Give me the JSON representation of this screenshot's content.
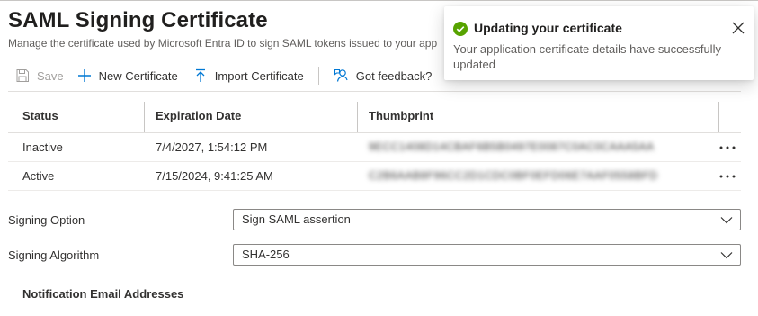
{
  "page": {
    "title": "SAML Signing Certificate",
    "subtitle": "Manage the certificate used by Microsoft Entra ID to sign SAML tokens issued to your app"
  },
  "toolbar": {
    "save_label": "Save",
    "new_label": "New Certificate",
    "import_label": "Import Certificate",
    "feedback_label": "Got feedback?"
  },
  "table": {
    "columns": [
      "Status",
      "Expiration Date",
      "Thumbprint"
    ],
    "rows": [
      {
        "status": "Inactive",
        "expiration": "7/4/2027, 1:54:12 PM",
        "thumbprint": "9ECC1408D14CBAF6B5B0497E0087C0AC0CAAA5AA",
        "more": "•••"
      },
      {
        "status": "Active",
        "expiration": "7/15/2024, 9:41:25 AM",
        "thumbprint": "C2B6AAB8F96CC2D1CDC0BF0EFD06E7AAF0558BFD",
        "more": "•••"
      }
    ]
  },
  "signing_option": {
    "label": "Signing Option",
    "value": "Sign SAML assertion"
  },
  "signing_algorithm": {
    "label": "Signing Algorithm",
    "value": "SHA-256"
  },
  "notification": {
    "title": "Notification Email Addresses"
  },
  "toast": {
    "title": "Updating your certificate",
    "message": "Your application certificate details have successfully updated",
    "status_color": "#57a300",
    "icon": "success-check-icon"
  },
  "colors": {
    "accent": "#0078d4",
    "text": "#323130",
    "border": "#8a8886"
  }
}
